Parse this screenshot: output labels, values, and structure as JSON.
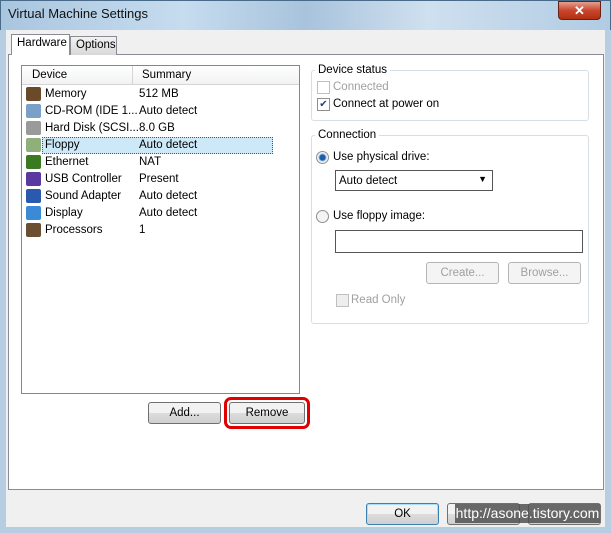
{
  "window": {
    "title": "Virtual Machine Settings",
    "close_icon": "close-icon"
  },
  "tabs": [
    {
      "label": "Hardware",
      "active": true
    },
    {
      "label": "Options",
      "active": false
    }
  ],
  "device_list": {
    "columns": [
      "Device",
      "Summary"
    ],
    "selected_index": 3,
    "rows": [
      {
        "device": "Memory",
        "summary": "512 MB",
        "icon": "memory-icon"
      },
      {
        "device": "CD-ROM (IDE 1...",
        "summary": "Auto detect",
        "icon": "cdrom-icon"
      },
      {
        "device": "Hard Disk (SCSI...",
        "summary": "8.0 GB",
        "icon": "hard-disk-icon"
      },
      {
        "device": "Floppy",
        "summary": "Auto detect",
        "icon": "floppy-icon"
      },
      {
        "device": "Ethernet",
        "summary": "NAT",
        "icon": "ethernet-icon"
      },
      {
        "device": "USB Controller",
        "summary": "Present",
        "icon": "usb-icon"
      },
      {
        "device": "Sound Adapter",
        "summary": "Auto detect",
        "icon": "sound-icon"
      },
      {
        "device": "Display",
        "summary": "Auto detect",
        "icon": "display-icon"
      },
      {
        "device": "Processors",
        "summary": "1",
        "icon": "processor-icon"
      }
    ]
  },
  "buttons": {
    "add": "Add...",
    "remove": "Remove",
    "ok": "OK"
  },
  "device_status": {
    "label": "Device status",
    "connected": {
      "label": "Connected",
      "checked": false,
      "enabled": false
    },
    "connect_at_power_on": {
      "label": "Connect at power on",
      "checked": true
    }
  },
  "connection": {
    "label": "Connection",
    "physical": {
      "label": "Use physical drive:",
      "selected": true,
      "value": "Auto detect"
    },
    "image": {
      "label": "Use floppy image:",
      "selected": false,
      "value": ""
    },
    "create": "Create...",
    "browse": "Browse...",
    "read_only": {
      "label": "Read Only",
      "checked": false,
      "enabled": false
    }
  },
  "watermark": "http://asone.tistory.com",
  "colors": {
    "highlight": "#e00000",
    "selection": "#cde8f7"
  }
}
